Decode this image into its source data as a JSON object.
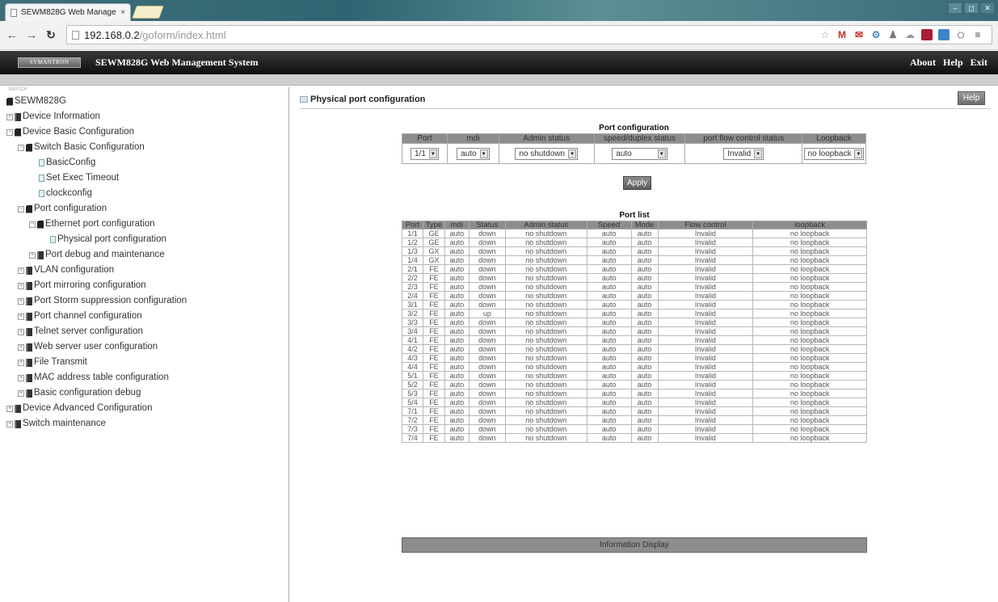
{
  "browser": {
    "tab_title": "SEWM828G Web Manage",
    "tab_close": "×",
    "url_host": "192.168.0.2",
    "url_path": "/goform/index.html",
    "window_controls": [
      "–",
      "◻",
      "✕"
    ]
  },
  "header": {
    "logo_text": "SYMANTRON",
    "title": "SEWM828G Web Management System",
    "links": {
      "about": "About",
      "help": "Help",
      "exit": "Exit"
    }
  },
  "sidebar": {
    "top_label": "SWITCH",
    "items": [
      {
        "label": "SEWM828G",
        "indent": 0,
        "toggle": "",
        "icon": "folder"
      },
      {
        "label": "Device Information",
        "indent": 0,
        "toggle": "+",
        "icon": "book"
      },
      {
        "label": "Device Basic Configuration",
        "indent": 0,
        "toggle": "−",
        "icon": "folder"
      },
      {
        "label": "Switch Basic Configuration",
        "indent": 1,
        "toggle": "−",
        "icon": "folder"
      },
      {
        "label": "BasicConfig",
        "indent": 2,
        "toggle": "",
        "icon": "page"
      },
      {
        "label": "Set Exec Timeout",
        "indent": 2,
        "toggle": "",
        "icon": "page"
      },
      {
        "label": "clockconfig",
        "indent": 2,
        "toggle": "",
        "icon": "page"
      },
      {
        "label": "Port configuration",
        "indent": 1,
        "toggle": "−",
        "icon": "folder"
      },
      {
        "label": "Ethernet port configuration",
        "indent": 2,
        "toggle": "−",
        "icon": "folder"
      },
      {
        "label": "Physical port configuration",
        "indent": 3,
        "toggle": "",
        "icon": "page"
      },
      {
        "label": "Port debug and maintenance",
        "indent": 2,
        "toggle": "+",
        "icon": "book"
      },
      {
        "label": "VLAN configuration",
        "indent": 1,
        "toggle": "+",
        "icon": "book"
      },
      {
        "label": "Port mirroring configuration",
        "indent": 1,
        "toggle": "+",
        "icon": "book"
      },
      {
        "label": "Port Storm suppression configuration",
        "indent": 1,
        "toggle": "+",
        "icon": "book"
      },
      {
        "label": "Port channel configuration",
        "indent": 1,
        "toggle": "+",
        "icon": "book"
      },
      {
        "label": "Telnet server configuration",
        "indent": 1,
        "toggle": "+",
        "icon": "book"
      },
      {
        "label": "Web server user configuration",
        "indent": 1,
        "toggle": "+",
        "icon": "book"
      },
      {
        "label": "File Transmit",
        "indent": 1,
        "toggle": "+",
        "icon": "book"
      },
      {
        "label": "MAC address table configuration",
        "indent": 1,
        "toggle": "+",
        "icon": "book"
      },
      {
        "label": "Basic configuration debug",
        "indent": 1,
        "toggle": "+",
        "icon": "book"
      },
      {
        "label": "Device Advanced Configuration",
        "indent": 0,
        "toggle": "+",
        "icon": "book"
      },
      {
        "label": "Switch maintenance",
        "indent": 0,
        "toggle": "+",
        "icon": "book"
      }
    ]
  },
  "main": {
    "page_title": "Physical port configuration",
    "help_button": "Help",
    "config": {
      "caption": "Port configuration",
      "headers": [
        "Port",
        "mdi",
        "Admin status",
        "speed/duplex status",
        "port flow control status",
        "Loopback"
      ],
      "values": [
        "1/1",
        "auto",
        "no shutdown",
        "auto",
        "Invalid",
        "no loopback"
      ]
    },
    "apply_button": "Apply",
    "port_list": {
      "caption": "Port list",
      "headers": [
        "Port",
        "Type",
        "mdi",
        "Status",
        "Admin status",
        "Speed",
        "Mode",
        "Flow control",
        "loopback"
      ],
      "rows": [
        [
          "1/1",
          "GE",
          "auto",
          "down",
          "no shutdown",
          "auto",
          "auto",
          "Invalid",
          "no loopback"
        ],
        [
          "1/2",
          "GE",
          "auto",
          "down",
          "no shutdown",
          "auto",
          "auto",
          "Invalid",
          "no loopback"
        ],
        [
          "1/3",
          "GX",
          "auto",
          "down",
          "no shutdown",
          "auto",
          "auto",
          "Invalid",
          "no loopback"
        ],
        [
          "1/4",
          "GX",
          "auto",
          "down",
          "no shutdown",
          "auto",
          "auto",
          "Invalid",
          "no loopback"
        ],
        [
          "2/1",
          "FE",
          "auto",
          "down",
          "no shutdown",
          "auto",
          "auto",
          "Invalid",
          "no loopback"
        ],
        [
          "2/2",
          "FE",
          "auto",
          "down",
          "no shutdown",
          "auto",
          "auto",
          "Invalid",
          "no loopback"
        ],
        [
          "2/3",
          "FE",
          "auto",
          "down",
          "no shutdown",
          "auto",
          "auto",
          "Invalid",
          "no loopback"
        ],
        [
          "2/4",
          "FE",
          "auto",
          "down",
          "no shutdown",
          "auto",
          "auto",
          "Invalid",
          "no loopback"
        ],
        [
          "3/1",
          "FE",
          "auto",
          "down",
          "no shutdown",
          "auto",
          "auto",
          "Invalid",
          "no loopback"
        ],
        [
          "3/2",
          "FE",
          "auto",
          "up",
          "no shutdown",
          "auto",
          "auto",
          "Invalid",
          "no loopback"
        ],
        [
          "3/3",
          "FE",
          "auto",
          "down",
          "no shutdown",
          "auto",
          "auto",
          "Invalid",
          "no loopback"
        ],
        [
          "3/4",
          "FE",
          "auto",
          "down",
          "no shutdown",
          "auto",
          "auto",
          "Invalid",
          "no loopback"
        ],
        [
          "4/1",
          "FE",
          "auto",
          "down",
          "no shutdown",
          "auto",
          "auto",
          "Invalid",
          "no loopback"
        ],
        [
          "4/2",
          "FE",
          "auto",
          "down",
          "no shutdown",
          "auto",
          "auto",
          "Invalid",
          "no loopback"
        ],
        [
          "4/3",
          "FE",
          "auto",
          "down",
          "no shutdown",
          "auto",
          "auto",
          "Invalid",
          "no loopback"
        ],
        [
          "4/4",
          "FE",
          "auto",
          "down",
          "no shutdown",
          "auto",
          "auto",
          "Invalid",
          "no loopback"
        ],
        [
          "5/1",
          "FE",
          "auto",
          "down",
          "no shutdown",
          "auto",
          "auto",
          "Invalid",
          "no loopback"
        ],
        [
          "5/2",
          "FE",
          "auto",
          "down",
          "no shutdown",
          "auto",
          "auto",
          "Invalid",
          "no loopback"
        ],
        [
          "5/3",
          "FE",
          "auto",
          "down",
          "no shutdown",
          "auto",
          "auto",
          "Invalid",
          "no loopback"
        ],
        [
          "5/4",
          "FE",
          "auto",
          "down",
          "no shutdown",
          "auto",
          "auto",
          "Invalid",
          "no loopback"
        ],
        [
          "7/1",
          "FE",
          "auto",
          "down",
          "no shutdown",
          "auto",
          "auto",
          "Invalid",
          "no loopback"
        ],
        [
          "7/2",
          "FE",
          "auto",
          "down",
          "no shutdown",
          "auto",
          "auto",
          "Invalid",
          "no loopback"
        ],
        [
          "7/3",
          "FE",
          "auto",
          "down",
          "no shutdown",
          "auto",
          "auto",
          "Invalid",
          "no loopback"
        ],
        [
          "7/4",
          "FE",
          "auto",
          "down",
          "no shutdown",
          "auto",
          "auto",
          "Invalid",
          "no loopback"
        ]
      ]
    },
    "info_display": "Information Display"
  }
}
